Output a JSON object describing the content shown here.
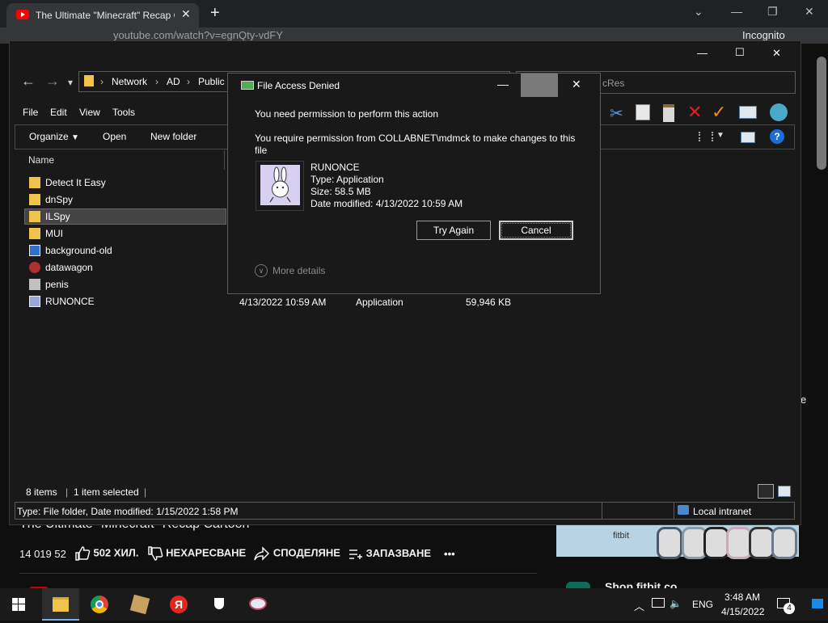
{
  "browser": {
    "tab_title": "The Ultimate \"Minecraft\" Recap C",
    "tab_close": "✕",
    "new_tab": "+",
    "url": "youtube.com/watch?v=egnQty-vdFY",
    "incognito": "Incognito",
    "window_controls": [
      "⌄",
      "—",
      "❐",
      "✕"
    ]
  },
  "youtube": {
    "title": "The Ultimate \"Minecraft\" Recap Cartoon",
    "views": "14 019 52",
    "likes": "502 ХИЛ.",
    "dislike": "НЕХАРЕСВАНЕ",
    "share": "СПОДЕЛЯНЕ",
    "save": "ЗАПАЗВАНЕ",
    "more": "•••",
    "ad_brand": "fitbit",
    "shop_text": "Shop fitbit co",
    "side_letter": "e"
  },
  "explorer": {
    "window_controls": [
      "—",
      "☐",
      "✕"
    ],
    "path": [
      "Network",
      "AD",
      "Public"
    ],
    "search_placeholder": "cRes",
    "menu": [
      "File",
      "Edit",
      "View",
      "Tools"
    ],
    "toolbar": {
      "organize": "Organize",
      "open": "Open",
      "new_folder": "New folder"
    },
    "column_name": "Name",
    "files": [
      {
        "name": "Detect It Easy",
        "icon": "folder-icon",
        "color": "#f1c34a"
      },
      {
        "name": "dnSpy",
        "icon": "folder-icon",
        "color": "#f1c34a"
      },
      {
        "name": "ILSpy",
        "icon": "folder-icon",
        "color": "#f1c34a"
      },
      {
        "name": "MUI",
        "icon": "folder-icon",
        "color": "#f1c34a"
      },
      {
        "name": "background-old",
        "icon": "image-file-icon",
        "color": "#2f6fcf"
      },
      {
        "name": "datawagon",
        "icon": "app-icon",
        "color": "#b03030"
      },
      {
        "name": "penis",
        "icon": "document-icon",
        "color": "#c0c0c0"
      },
      {
        "name": "RUNONCE",
        "icon": "executable-icon",
        "color": "#9aa6d8"
      }
    ],
    "runonce_details": {
      "date": "4/13/2022 10:59 AM",
      "type": "Application",
      "size": "59,946 KB"
    },
    "status": {
      "items": "8 items",
      "selected": "1 item selected",
      "details": "Type: File folder, Date modified: 1/15/2022 1:58 PM",
      "zone": "Local intranet"
    }
  },
  "dialog": {
    "title": "File Access Denied",
    "controls": [
      "—",
      "☐",
      "✕"
    ],
    "heading": "You need permission to perform this action",
    "message": "You require permission from COLLABNET\\mdmck to make changes to this file",
    "file_name": "RUNONCE",
    "file_type": "Type: Application",
    "file_size": "Size: 58.5 MB",
    "file_date": "Date modified: 4/13/2022 10:59 AM",
    "try_again": "Try Again",
    "cancel": "Cancel",
    "more_details": "More details"
  },
  "taskbar": {
    "language": "ENG",
    "time": "3:48 AM",
    "date": "4/15/2022",
    "notification_count": "4"
  }
}
